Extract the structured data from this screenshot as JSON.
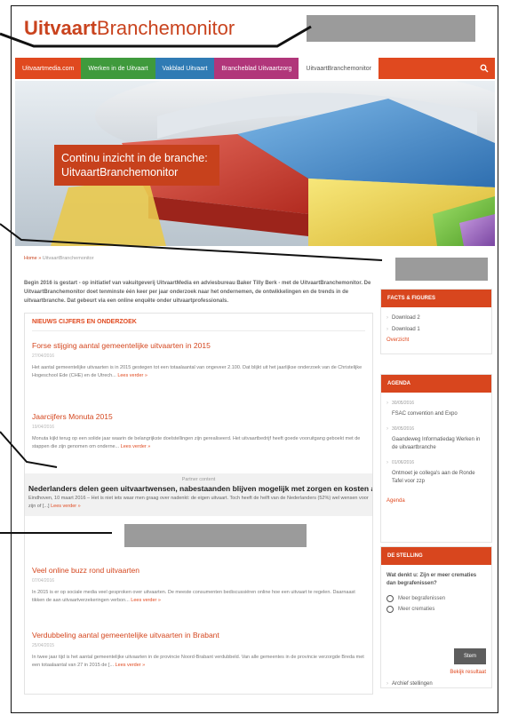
{
  "logo": {
    "bold": "Uitvaart",
    "light": "Branchemonitor"
  },
  "nav": {
    "tabs": [
      {
        "label": "Uitvaartmedia.com",
        "color": "#e0491f"
      },
      {
        "label": "Werken in de Uitvaart",
        "color": "#3f9a3c"
      },
      {
        "label": "Vakblad Uitvaart",
        "color": "#2f7bb4"
      },
      {
        "label": "Branche​blad Uitvaartzorg",
        "color": "#b1367a"
      },
      {
        "label": "UitvaartBranchemonitor",
        "color": "#ffffff"
      }
    ],
    "search_icon": "search-icon"
  },
  "hero": {
    "caption": "Continu inzicht in de branche: UitvaartBranchemonitor"
  },
  "breadcrumb": {
    "home": "Home",
    "sep": "»",
    "current": "UitvaartBranchemonitor"
  },
  "intro": "Begin 2016 is gestart - op initiatief van vakuitgeverij UitvaartMedia en adviesbureau Baker Tilly Berk - met de UitvaartBranchemonitor. De UitvaartBranchemonitor doet tenminste één keer per jaar onderzoek naar het ondernemen, de ontwikkelingen en de trends in de uitvaartbranche. Dat gebeurt via een online enquête onder uitvaartprofessionals.",
  "news": {
    "heading": "NIEUWS CIJFERS EN ONDERZOEK",
    "more_label": "Lees verder »",
    "articles": [
      {
        "title": "Forse stijging aantal gemeentelijke uitvaarten in 2015",
        "date": "27/04/2016",
        "excerpt": "Het aantal gemeentelijke uitvaarten is in 2015 gestegen tot een totaalaantal van ongeveer 2.100. Dat blijkt uit het jaarlijkse onderzoek van de Christelijke Hogeschool Ede (CHE) en de Utrech..."
      },
      {
        "title": "Jaarcijfers Monuta 2015",
        "date": "19/04/2016",
        "excerpt": "Monuta kijkt terug op een solide jaar waarin de belangrijkste doelstellingen zijn gerealiseerd. Het uitvaartbedrijf heeft goede vooruitgang geboekt met de stappen die zijn genomen om onderne..."
      },
      {
        "title": "Veel online buzz rond uitvaarten",
        "date": "07/04/2016",
        "excerpt": "In 2015 is er op sociale media veel gesproken over uitvaarten. De meeste consumenten bediscussiëren online hoe een uitvaart te regelen. Daarnaast tikken de aan uitvaartverzekeringen verbon..."
      },
      {
        "title": "Verdubbeling aantal gemeentelijke uitvaarten in Brabant",
        "date": "25/04/2015",
        "excerpt": "In twee jaar tijd is het aantal gemeentelijke uitvaarten in de provincie Noord-Brabant verdubbeld. Van alle gemeentes in de provincie verzorgde Breda met een totaalaantal van 27 in 2015 de [..."
      }
    ],
    "partner": {
      "label": "Partner content",
      "title": "Nederlanders delen geen uitvaartwensen, nabestaanden blijven mogelijk met zorgen en kosten achter",
      "excerpt": "Eindhoven, 10 maart 2016 – Het is niet iets waar men graag over nadenkt: de eigen uitvaart. Toch heeft de helft van de Nederlanders (52%) wel wensen voor zijn of [...]"
    }
  },
  "sidebar": {
    "facts": {
      "heading": "FACTS & FIGURES",
      "items": [
        "Download 2",
        "Download 1"
      ],
      "overview": "Overzicht"
    },
    "agenda": {
      "heading": "AGENDA",
      "items": [
        {
          "date": "30/05/2016",
          "title": "FSAC convention and Expo"
        },
        {
          "date": "30/05/2016",
          "title": "Gaandeweg Informatiedag Werken in de uitvaartbranche"
        },
        {
          "date": "01/06/2016",
          "title": "Ontmoet je collega's aan de Ronde Tafel voor zzp"
        }
      ],
      "link": "Agenda"
    },
    "poll": {
      "heading": "DE STELLING",
      "question": "Wat denkt u: Zijn er meer crematies dan begrafenissen?",
      "options": [
        "Meer begrafenissen",
        "Meer crematies"
      ],
      "vote_label": "Stem",
      "results_label": "Bekijk resultaat",
      "archive_label": "Archief stellingen"
    }
  }
}
